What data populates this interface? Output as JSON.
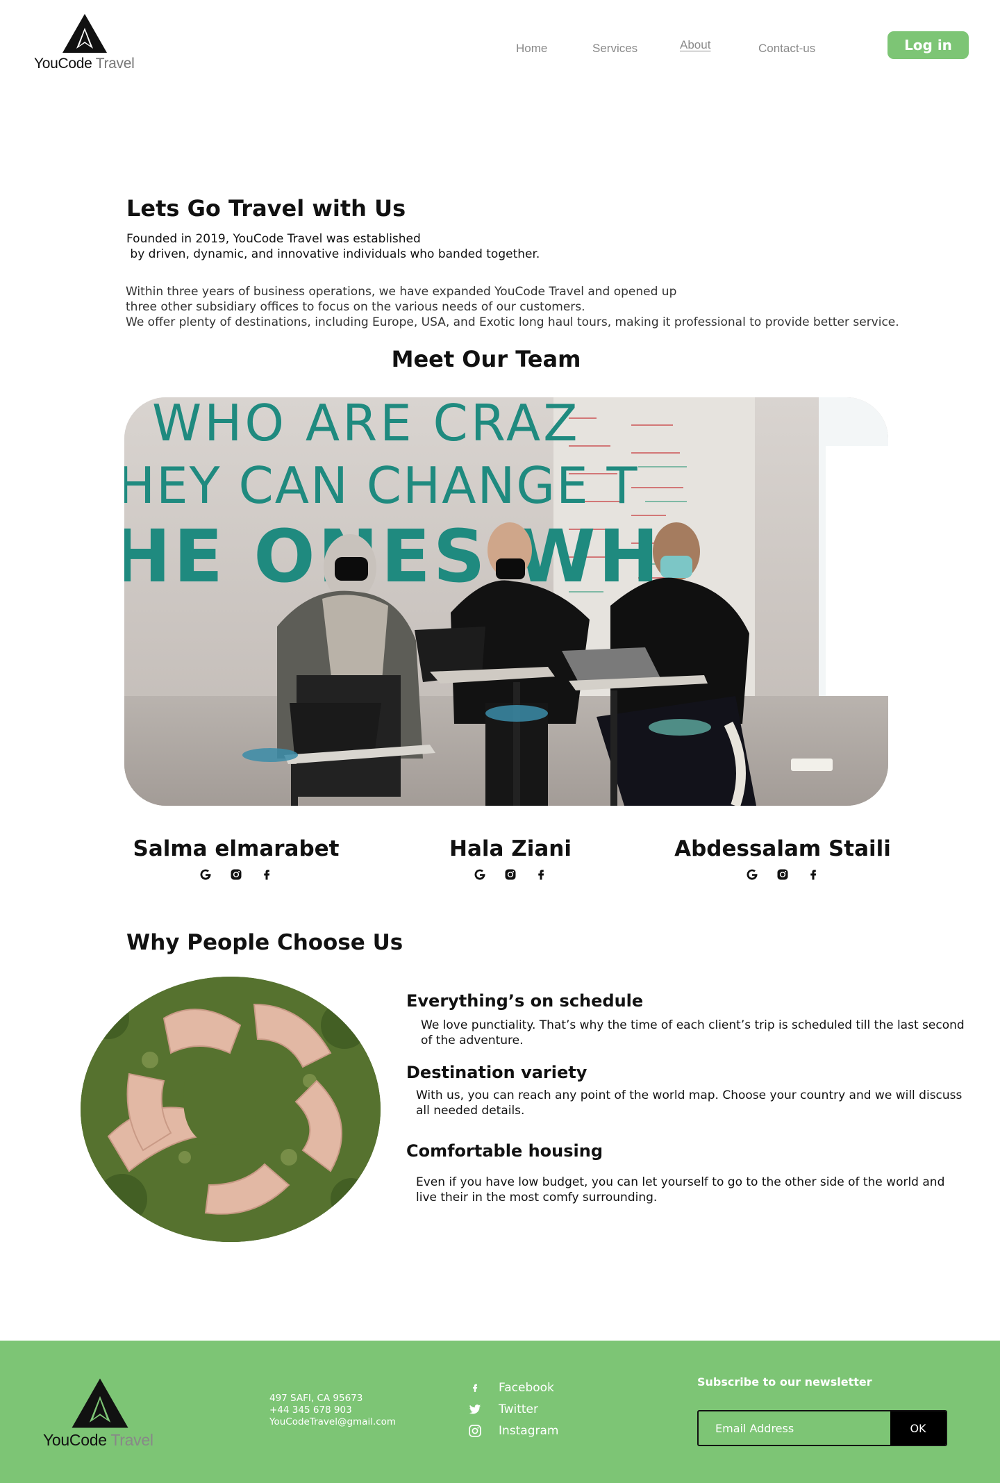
{
  "header": {
    "logo_text_primary": "YouCode",
    "logo_text_secondary": "Travel",
    "nav": {
      "home": "Home",
      "services": "Services",
      "about": "About",
      "contact": "Contact-us"
    },
    "login_label": "Log in",
    "accent_color": "#7dc575"
  },
  "about": {
    "title": "Lets Go Travel with Us",
    "founded": "Founded in 2019, YouCode Travel was established\n by driven, dynamic, and innovative individuals who banded together.",
    "within": "Within three years of business operations, we have expanded YouCode Travel and opened up\nthree other subsidiary offices to focus on the various needs of our customers.\nWe offer plenty of destinations, including Europe, USA, and Exotic long haul tours, making it professional to provide better service."
  },
  "team": {
    "title": "Meet Our Team",
    "photo_wall_text": [
      "WHO ARE CRAZ",
      "HEY CAN CHANGE T",
      "HE ONES WH"
    ],
    "members": [
      {
        "name": "Salma elmarabet"
      },
      {
        "name": "Hala Ziani"
      },
      {
        "name": "Abdessalam Staili"
      }
    ],
    "social_icons": [
      "google-icon",
      "instagram-icon",
      "facebook-icon"
    ]
  },
  "why": {
    "title": "Why People Choose Us",
    "features": [
      {
        "title": "Everything’s on schedule",
        "text": "We love punctiality. That’s why the time of each client’s trip is scheduled till the last second of the adventure."
      },
      {
        "title": "Destination variety",
        "text": "With us, you can reach any point of the world map. Choose your country and we will discuss all needed details."
      },
      {
        "title": "Comfortable housing",
        "text": "Even if you have low budget, you can let yourself to go to the other side of the world and live their in the most comfy surrounding."
      }
    ]
  },
  "footer": {
    "logo_text_primary": "YouCode",
    "logo_text_secondary": "Travel",
    "address": "497  SAFI, CA 95673",
    "phone": "+44 345 678 903",
    "email": "YouCodeTravel@gmail.com",
    "social": {
      "facebook": "Facebook",
      "twitter": "Twitter",
      "instagram": "Instagram"
    },
    "newsletter_title": "Subscribe to our newsletter",
    "newsletter_placeholder": "Email Address",
    "newsletter_button": "OK",
    "background_color": "#7dc575"
  }
}
